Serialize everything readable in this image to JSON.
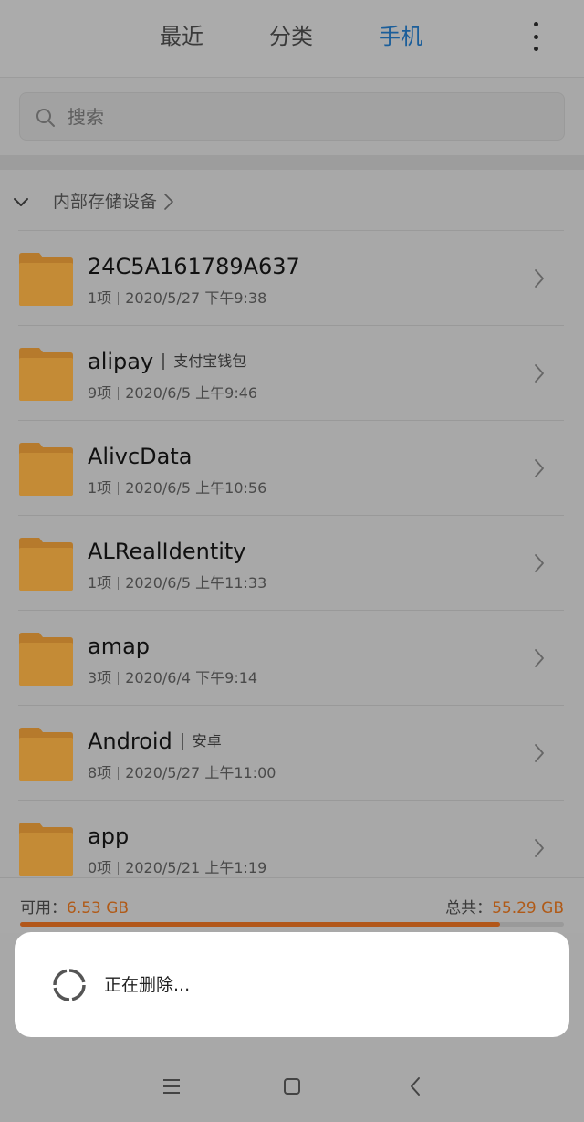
{
  "tabs": {
    "recent": "最近",
    "category": "分类",
    "phone": "手机",
    "active": "手机"
  },
  "search": {
    "placeholder": "搜索"
  },
  "breadcrumb": {
    "label": "内部存储设备"
  },
  "folders": [
    {
      "name": "24C5A161789A637",
      "tag": "",
      "count": "1项",
      "date": "2020/5/27 下午9:38"
    },
    {
      "name": "alipay",
      "tag": "支付宝钱包",
      "count": "9项",
      "date": "2020/6/5 上午9:46"
    },
    {
      "name": "AlivcData",
      "tag": "",
      "count": "1项",
      "date": "2020/6/5 上午10:56"
    },
    {
      "name": "ALRealIdentity",
      "tag": "",
      "count": "1项",
      "date": "2020/6/5 上午11:33"
    },
    {
      "name": "amap",
      "tag": "",
      "count": "3项",
      "date": "2020/6/4 下午9:14"
    },
    {
      "name": "Android",
      "tag": "安卓",
      "count": "8项",
      "date": "2020/5/27 上午11:00"
    },
    {
      "name": "app",
      "tag": "",
      "count": "0项",
      "date": "2020/5/21 上午1:19"
    }
  ],
  "storage": {
    "available_label": "可用：",
    "available_value": "6.53 GB",
    "total_label": "总共：",
    "total_value": "55.29 GB",
    "used_fraction": 0.882
  },
  "dialog": {
    "message": "正在删除..."
  },
  "colors": {
    "accent": "#1b5e9a",
    "folder": "#c48b36",
    "storage_bar": "#b2571a"
  },
  "icons": {
    "more": "more-vertical-icon",
    "search": "search-icon",
    "toggle": "chevron-down-icon",
    "row_arrow": "chevron-right-icon",
    "folder": "folder-icon",
    "spinner": "spinner-icon",
    "nav_menu": "menu-icon",
    "nav_home": "home-icon",
    "nav_back": "back-icon"
  }
}
